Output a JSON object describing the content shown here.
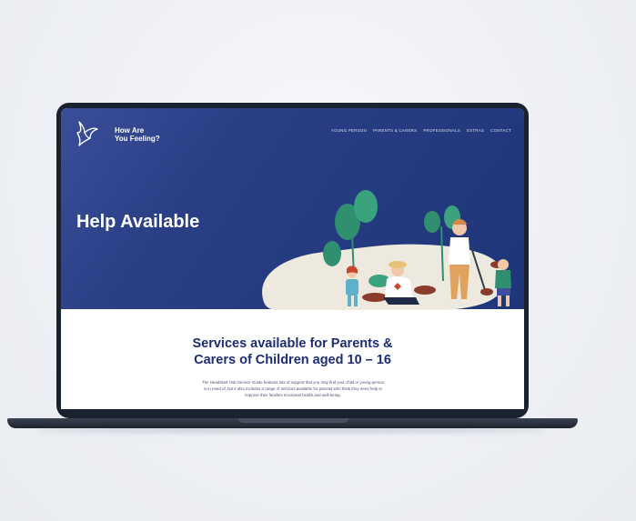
{
  "site": {
    "logo_line1": "How Are",
    "logo_line2": "You Feeling?"
  },
  "nav": {
    "items": [
      "YOUNG PERSON",
      "PARENTS & CARERS",
      "PROFESSIONALS",
      "EXTRAS",
      "CONTACT"
    ]
  },
  "hero": {
    "title": "Help Available"
  },
  "content": {
    "title_line1": "Services available for Parents &",
    "title_line2": "Carers of Children aged 10 – 16",
    "body_line1": "The HeadStart Hub Service Guide features lots of support that you may find your child or young person",
    "body_line2": "is in need of, but it also includes a range of services available for parents who think they need help to",
    "body_line3": "improve their families emotional health and well-being."
  },
  "colors": {
    "hero_bg": "#233a80",
    "heading": "#1e2c73",
    "device": "#1a2230",
    "page_bg": "#eef0f4"
  }
}
